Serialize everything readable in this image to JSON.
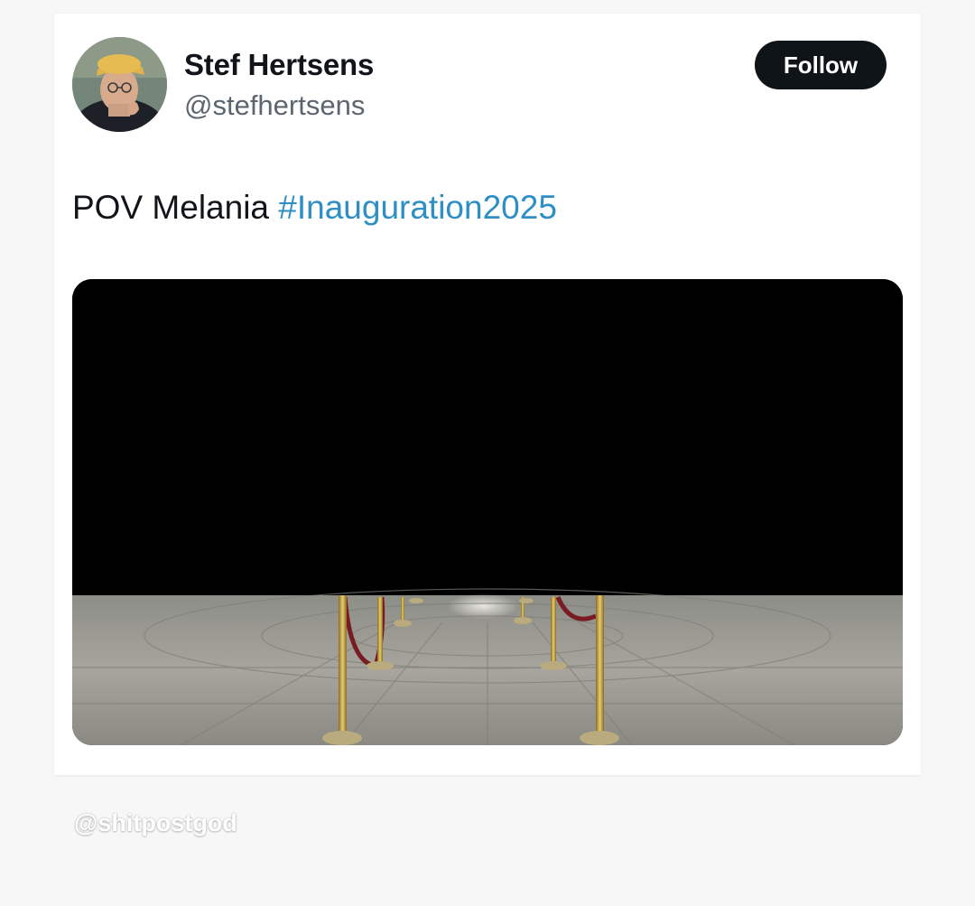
{
  "tweet": {
    "author": {
      "display_name": "Stef Hertsens",
      "handle": "@stefhertsens"
    },
    "follow_label": "Follow",
    "text": "POV Melania",
    "hashtag": "#Inauguration2025",
    "media": {
      "icon": "video-thumbnail",
      "description_colors": {
        "top_fill": "#000000",
        "rope": "#7a1b22",
        "brass": "#c9a84a",
        "floor": "#9a9a93"
      }
    }
  },
  "watermark": "@shitpostgod",
  "colors": {
    "background": "#f7f7f7",
    "card": "#ffffff",
    "hashtag": "#2e8fc4",
    "follow_bg": "#0f1419",
    "follow_text": "#ffffff",
    "handle": "#5b6670"
  }
}
